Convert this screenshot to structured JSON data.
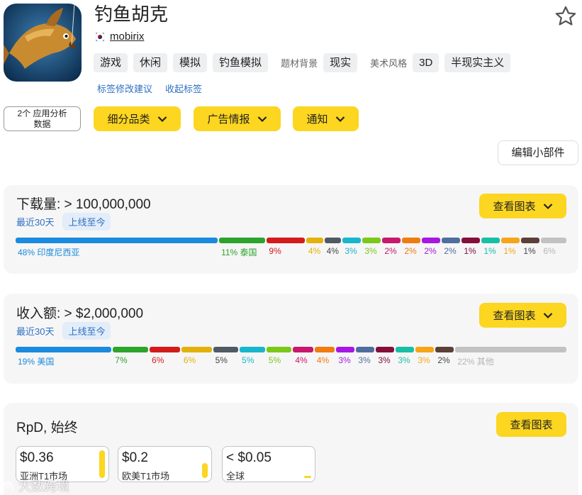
{
  "app": {
    "title": "钓鱼胡克",
    "developer": "mobirix",
    "developer_flag": "kr-flag-icon",
    "icon": "fishing-game-app-icon"
  },
  "tags": {
    "genre": [
      "游戏",
      "休闲",
      "模拟",
      "钓鱼模拟"
    ],
    "theme_label": "题材背景",
    "theme": "现实",
    "style_label": "美术风格",
    "style": [
      "3D",
      "半现实主义"
    ],
    "suggest_link": "标签修改建议",
    "collapse_link": "收起标签"
  },
  "toolbar": {
    "analysis_line1": "2个 应用分析",
    "analysis_line2": "数据",
    "subcategory": "细分品类",
    "ad_intel": "广告情报",
    "notify": "通知",
    "edit_widget": "编辑小部件"
  },
  "downloads": {
    "title": "下载量: > 100,000,000",
    "period_1": "最近30天",
    "period_2": "上线至今",
    "chart_button": "查看图表",
    "segments": [
      {
        "pct": 48,
        "label": "48% 印度尼西亚",
        "color": "#1a8bde"
      },
      {
        "pct": 11,
        "label": "11% 泰国",
        "color": "#2ca42c"
      },
      {
        "pct": 9,
        "label": "9%",
        "color": "#d51a1a"
      },
      {
        "pct": 4,
        "label": "4%",
        "color": "#e3b10c"
      },
      {
        "pct": 4,
        "label": "4%",
        "color": "#4f5a63"
      },
      {
        "pct": 3,
        "label": "3%",
        "color": "#16b6cc"
      },
      {
        "pct": 3,
        "label": "3%",
        "color": "#7cc817"
      },
      {
        "pct": 2,
        "label": "2%",
        "color": "#c8176c"
      },
      {
        "pct": 2,
        "label": "2%",
        "color": "#f07b10"
      },
      {
        "pct": 2,
        "label": "2%",
        "color": "#a617e6"
      },
      {
        "pct": 2,
        "label": "2%",
        "color": "#4e6e9f"
      },
      {
        "pct": 1,
        "label": "1%",
        "color": "#840f3a"
      },
      {
        "pct": 1,
        "label": "1%",
        "color": "#17bfa6"
      },
      {
        "pct": 1,
        "label": "1%",
        "color": "#f6a418"
      },
      {
        "pct": 1,
        "label": "1%",
        "color": "#5c4038"
      },
      {
        "pct": 6,
        "label": "6%",
        "color": "#c2c2c2"
      }
    ]
  },
  "revenue": {
    "title": "收入额: > $2,000,000",
    "period_1": "最近30天",
    "period_2": "上线至今",
    "chart_button": "查看图表",
    "segments": [
      {
        "pct": 19,
        "label": "19% 美国",
        "color": "#1a8bde"
      },
      {
        "pct": 7,
        "label": "7%",
        "color": "#2ca42c"
      },
      {
        "pct": 6,
        "label": "6%",
        "color": "#d51a1a"
      },
      {
        "pct": 6,
        "label": "6%",
        "color": "#e3b10c"
      },
      {
        "pct": 5,
        "label": "5%",
        "color": "#4f5a63"
      },
      {
        "pct": 5,
        "label": "5%",
        "color": "#16b6cc"
      },
      {
        "pct": 5,
        "label": "5%",
        "color": "#7cc817"
      },
      {
        "pct": 4,
        "label": "4%",
        "color": "#c8176c"
      },
      {
        "pct": 4,
        "label": "4%",
        "color": "#f07b10"
      },
      {
        "pct": 3,
        "label": "3%",
        "color": "#a617e6"
      },
      {
        "pct": 3,
        "label": "3%",
        "color": "#4e6e9f"
      },
      {
        "pct": 3,
        "label": "3%",
        "color": "#840f3a"
      },
      {
        "pct": 3,
        "label": "3%",
        "color": "#17bfa6"
      },
      {
        "pct": 3,
        "label": "3%",
        "color": "#f6a418"
      },
      {
        "pct": 2,
        "label": "2%",
        "color": "#5c4038"
      },
      {
        "pct": 22,
        "label": "22% 其他",
        "color": "#c2c2c2"
      }
    ]
  },
  "rpd": {
    "title": "RpD, 始终",
    "chart_button": "查看图表",
    "boxes": [
      {
        "value": "$0.36",
        "label": "亚洲T1市场",
        "level": 1.0
      },
      {
        "value": "$0.2",
        "label": "欧美T1市场",
        "level": 0.55
      },
      {
        "value": "< $0.05",
        "label": "全球",
        "level": 0.1
      }
    ]
  },
  "watermark": "大数跨境",
  "colors": {
    "accent_yellow": "#fcd620",
    "link_blue": "#2f6fc4",
    "card_bg": "#f6f6f6"
  }
}
